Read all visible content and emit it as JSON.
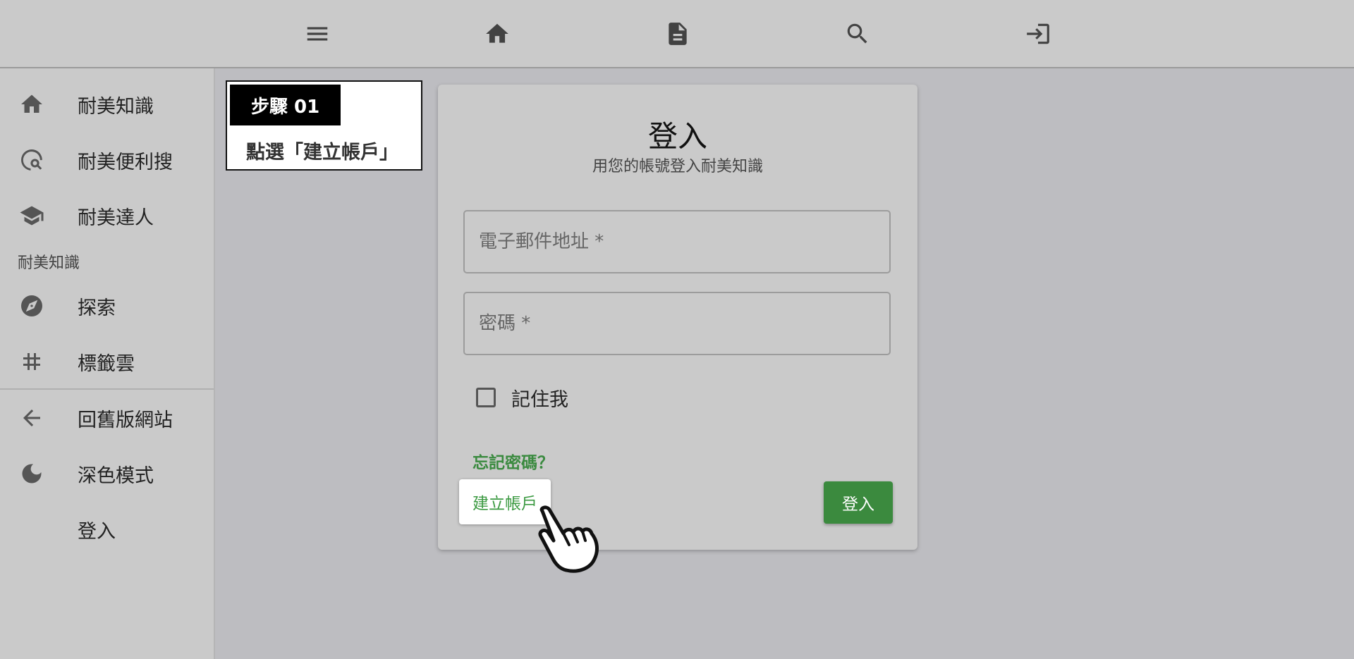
{
  "topbar": {
    "icons": [
      "menu-icon",
      "home-icon",
      "document-icon",
      "search-icon",
      "login-icon"
    ]
  },
  "sidebar": {
    "items": [
      {
        "label": "耐美知識",
        "icon": "home-icon"
      },
      {
        "label": "耐美便利搜",
        "icon": "travel-explore-icon"
      },
      {
        "label": "耐美達人",
        "icon": "school-icon"
      }
    ],
    "section_label": "耐美知識",
    "section_items": [
      {
        "label": "探索",
        "icon": "compass-icon"
      },
      {
        "label": "標籤雲",
        "icon": "hashtag-icon"
      }
    ],
    "footer_items": [
      {
        "label": "回舊版網站",
        "icon": "arrow-back-icon"
      },
      {
        "label": "深色模式",
        "icon": "moon-icon"
      },
      {
        "label": "登入",
        "icon": ""
      }
    ]
  },
  "step": {
    "badge": "步驟 01",
    "text": "點選「建立帳戶」"
  },
  "login": {
    "title": "登入",
    "subtitle": "用您的帳號登入耐美知識",
    "email_placeholder": "電子郵件地址 *",
    "password_placeholder": "密碼 *",
    "remember_label": "記住我",
    "forgot_link": "忘記密碼？",
    "create_account": "建立帳戶",
    "submit": "登入"
  },
  "colors": {
    "accent_green": "#3b8a3e",
    "link_green": "#3a8a3f",
    "topbar_bg": "#cacaca",
    "main_bg": "#bdbdc1"
  }
}
